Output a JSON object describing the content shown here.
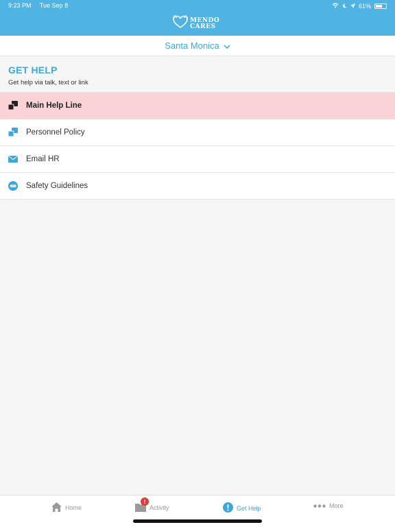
{
  "status_bar": {
    "time": "9:23 PM",
    "date": "Tue Sep 8",
    "battery": "61%",
    "battery_level": 0.61
  },
  "app": {
    "logo_line1": "MENDO",
    "logo_line2": "CARES"
  },
  "location": {
    "name": "Santa Monica"
  },
  "section": {
    "title": "GET HELP",
    "subtitle": "Get help via talk, text or link"
  },
  "help_items": [
    {
      "label": "Main Help Line",
      "icon": "chat-bubbles-icon"
    },
    {
      "label": "Personnel Policy",
      "icon": "chat-bubbles-icon"
    },
    {
      "label": "Email HR",
      "icon": "envelope-icon"
    },
    {
      "label": "Safety Guidelines",
      "icon": "link-icon"
    }
  ],
  "tabs": [
    {
      "label": "Home",
      "icon": "house-icon"
    },
    {
      "label": "Activity",
      "icon": "folder-icon",
      "badge": "!"
    },
    {
      "label": "Get Help",
      "icon": "exclamation-icon"
    },
    {
      "label": "More",
      "icon": "ellipsis-icon"
    }
  ],
  "colors": {
    "brand": "#4fb3e3",
    "accent_text": "#3aa8db",
    "active_row": "#f9d3d6",
    "badge": "#e23b3b"
  }
}
